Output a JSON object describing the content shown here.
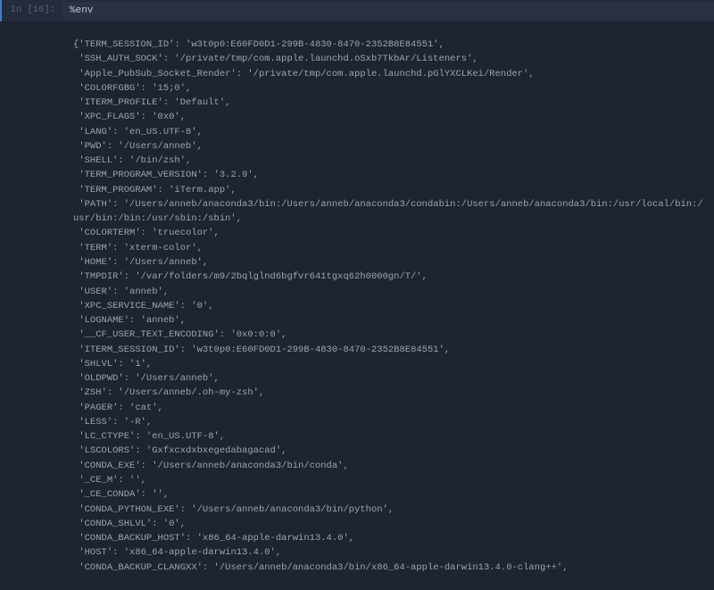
{
  "prompt": {
    "in_label": "In [16]:"
  },
  "input": {
    "command": "%env"
  },
  "output": {
    "lines": [
      "{'TERM_SESSION_ID': 'w3t0p0:E60FD0D1-299B-4830-8470-2352B8E84551',",
      " 'SSH_AUTH_SOCK': '/private/tmp/com.apple.launchd.oSxb7TkbAr/Listeners',",
      " 'Apple_PubSub_Socket_Render': '/private/tmp/com.apple.launchd.pGlYXCLKei/Render',",
      " 'COLORFGBG': '15;0',",
      " 'ITERM_PROFILE': 'Default',",
      " 'XPC_FLAGS': '0x0',",
      " 'LANG': 'en_US.UTF-8',",
      " 'PWD': '/Users/anneb',",
      " 'SHELL': '/bin/zsh',",
      " 'TERM_PROGRAM_VERSION': '3.2.9',",
      " 'TERM_PROGRAM': 'iTerm.app',",
      " 'PATH': '/Users/anneb/anaconda3/bin:/Users/anneb/anaconda3/condabin:/Users/anneb/anaconda3/bin:/usr/local/bin:/usr/bin:/bin:/usr/sbin:/sbin',",
      " 'COLORTERM': 'truecolor',",
      " 'TERM': 'xterm-color',",
      " 'HOME': '/Users/anneb',",
      " 'TMPDIR': '/var/folders/m9/2bqlglnd6bgfvr641tgxq62h0000gn/T/',",
      " 'USER': 'anneb',",
      " 'XPC_SERVICE_NAME': '0',",
      " 'LOGNAME': 'anneb',",
      " '__CF_USER_TEXT_ENCODING': '0x0:0:0',",
      " 'ITERM_SESSION_ID': 'w3t0p0:E60FD0D1-299B-4830-8470-2352B8E84551',",
      " 'SHLVL': '1',",
      " 'OLDPWD': '/Users/anneb',",
      " 'ZSH': '/Users/anneb/.oh-my-zsh',",
      " 'PAGER': 'cat',",
      " 'LESS': '-R',",
      " 'LC_CTYPE': 'en_US.UTF-8',",
      " 'LSCOLORS': 'Gxfxcxdxbxegedabagacad',",
      " 'CONDA_EXE': '/Users/anneb/anaconda3/bin/conda',",
      " '_CE_M': '',",
      " '_CE_CONDA': '',",
      " 'CONDA_PYTHON_EXE': '/Users/anneb/anaconda3/bin/python',",
      " 'CONDA_SHLVL': '0',",
      " 'CONDA_BACKUP_HOST': 'x86_64-apple-darwin13.4.0',",
      " 'HOST': 'x86_64-apple-darwin13.4.0',",
      " 'CONDA_BACKUP_CLANGXX': '/Users/anneb/anaconda3/bin/x86_64-apple-darwin13.4.0-clang++',"
    ]
  }
}
